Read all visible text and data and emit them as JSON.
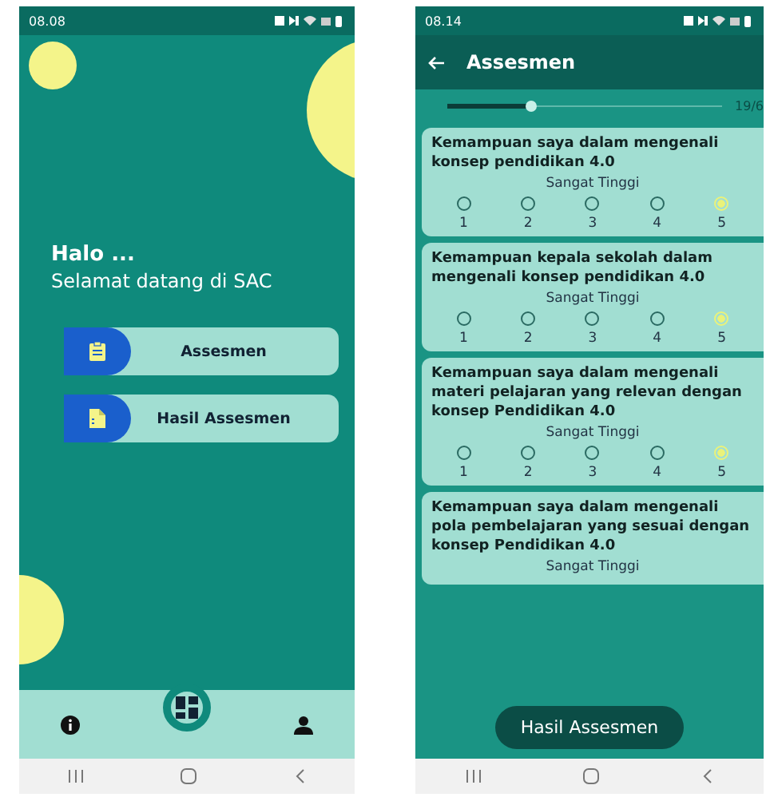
{
  "left_phone": {
    "status_bar": {
      "time": "08.08"
    },
    "greeting": "Halo ...",
    "welcome": "Selamat datang di SAC",
    "menu_buttons": [
      {
        "label": "Assesmen",
        "kind": "clipboard"
      },
      {
        "label": "Hasil Assesmen",
        "kind": "document"
      }
    ],
    "bottom_nav": [
      {
        "kind": "info",
        "selected": false
      },
      {
        "kind": "dashboard",
        "selected": true
      },
      {
        "kind": "profile",
        "selected": false
      }
    ]
  },
  "right_phone": {
    "status_bar": {
      "time": "08.14"
    },
    "app_bar": {
      "title": "Assesmen"
    },
    "progress": {
      "level": 0.3,
      "reading": "19/6"
    },
    "questions": [
      {
        "text": "Kemampuan saya dalam mengenali konsep pendidikan 4.0",
        "answer_label": "Sangat Tinggi",
        "options": [
          {
            "label": "1",
            "selected": false
          },
          {
            "label": "2",
            "selected": false
          },
          {
            "label": "3",
            "selected": false
          },
          {
            "label": "4",
            "selected": false
          },
          {
            "label": "5",
            "selected": true
          }
        ]
      },
      {
        "text": "Kemampuan kepala sekolah dalam mengenali konsep pendidikan 4.0",
        "answer_label": "Sangat Tinggi",
        "options": [
          {
            "label": "1",
            "selected": false
          },
          {
            "label": "2",
            "selected": false
          },
          {
            "label": "3",
            "selected": false
          },
          {
            "label": "4",
            "selected": false
          },
          {
            "label": "5",
            "selected": true
          }
        ]
      },
      {
        "text": "Kemampuan saya dalam mengenali materi pelajaran yang relevan dengan konsep Pendidikan 4.0",
        "answer_label": "Sangat Tinggi",
        "options": [
          {
            "label": "1",
            "selected": false
          },
          {
            "label": "2",
            "selected": false
          },
          {
            "label": "3",
            "selected": false
          },
          {
            "label": "4",
            "selected": false
          },
          {
            "label": "5",
            "selected": true
          }
        ]
      },
      {
        "text": "Kemampuan saya dalam mengenali pola pembelajaran yang sesuai dengan konsep Pendidikan 4.0",
        "answer_label": "Sangat Tinggi"
      }
    ],
    "submit_button": "Hasil Assesmen"
  }
}
